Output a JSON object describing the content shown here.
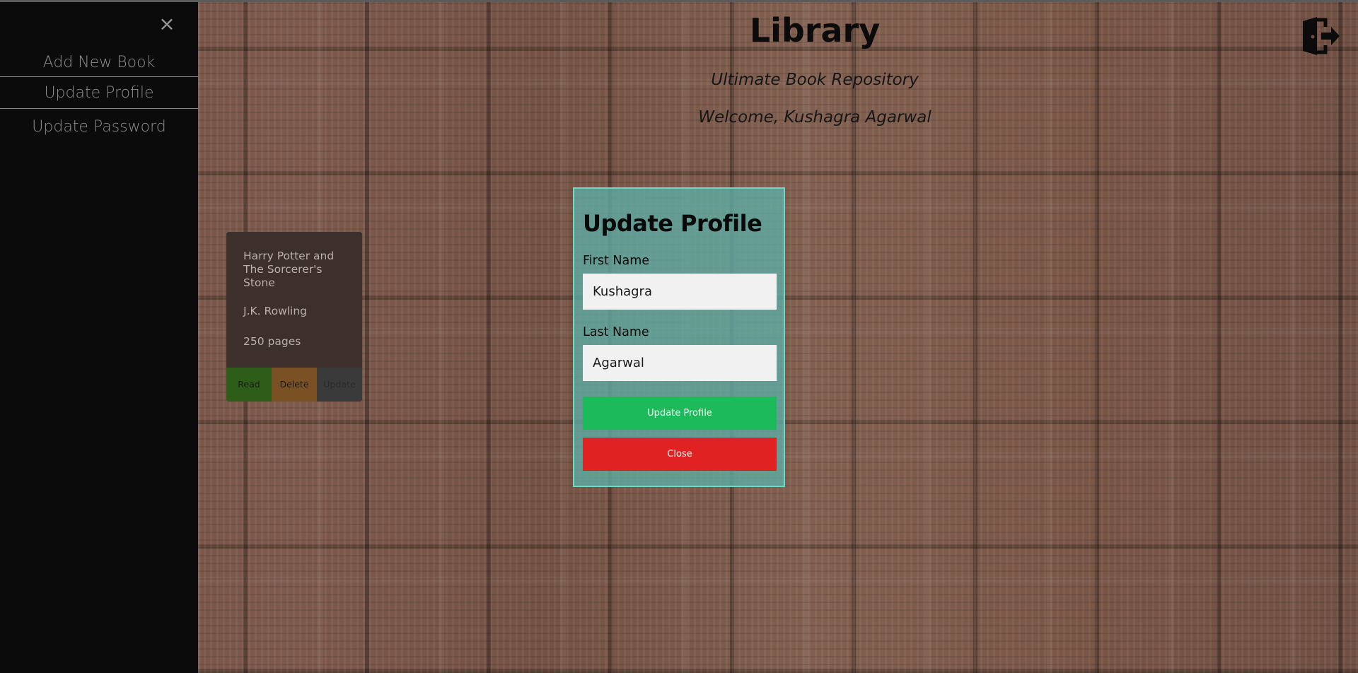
{
  "sidebar": {
    "close_glyph": "×",
    "items": [
      {
        "label": "Add New Book"
      },
      {
        "label": "Update Profile"
      },
      {
        "label": "Update Password"
      }
    ]
  },
  "header": {
    "title": "Library",
    "subtitle": "Ultimate Book Repository",
    "welcome": "Welcome, Kushagra Agarwal",
    "logout_icon": "logout-icon"
  },
  "book": {
    "title": "Harry Potter and The Sorcerer's Stone",
    "author": "J.K. Rowling",
    "pages": "250 pages",
    "actions": {
      "read": "Read",
      "delete": "Delete",
      "update": "Update"
    }
  },
  "modal": {
    "title": "Update Profile",
    "first_name_label": "First Name",
    "first_name_value": "Kushagra",
    "last_name_label": "Last Name",
    "last_name_value": "Agarwal",
    "submit_label": "Update Profile",
    "close_label": "Close"
  },
  "colors": {
    "sidebar_bg": "#0b0b0b",
    "modal_border": "#6ed8c8",
    "submit": "#1cba5a",
    "close": "#e12222",
    "read": "#2e5c19",
    "delete": "#7a5125"
  }
}
